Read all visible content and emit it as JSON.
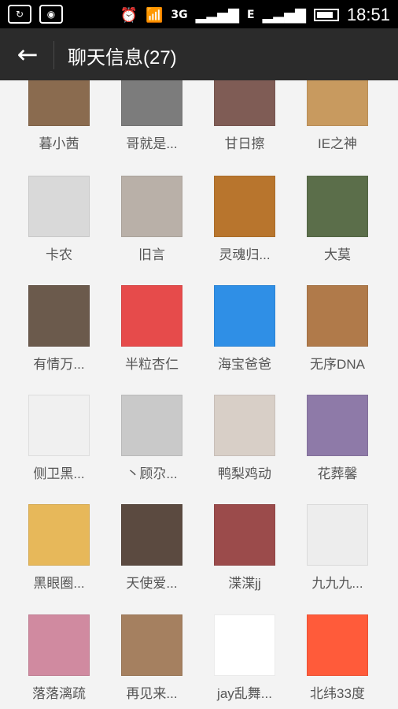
{
  "status_bar": {
    "left_icons": [
      "sync-icon",
      "shield-icon"
    ],
    "right_icons": [
      "alarm-clock-icon",
      "wifi-icon",
      "3g-icon",
      "signal-icon",
      "e-icon",
      "signal-icon",
      "battery-icon"
    ],
    "time": "18:51"
  },
  "header": {
    "back_icon": "arrow-left-icon",
    "title": "聊天信息(27)"
  },
  "members": [
    {
      "name": "暮小茜",
      "color": "#8a6b4f"
    },
    {
      "name": "哥就是...",
      "color": "#7c7c7c"
    },
    {
      "name": "甘日擦",
      "color": "#7f5c55"
    },
    {
      "name": "IE之神",
      "color": "#c89a5f"
    },
    {
      "name": "卡农",
      "color": "#d9d9d9"
    },
    {
      "name": "旧言",
      "color": "#b9b0a8"
    },
    {
      "name": "灵魂归...",
      "color": "#b8752d"
    },
    {
      "name": "大莫",
      "color": "#5b6e4a"
    },
    {
      "name": "有情万...",
      "color": "#6b5a4c"
    },
    {
      "name": "半粒杏仁",
      "color": "#e64b4b"
    },
    {
      "name": "海宝爸爸",
      "color": "#2f8fe6"
    },
    {
      "name": "无序DNA",
      "color": "#b07a4a"
    },
    {
      "name": "侧卫黑...",
      "color": "#f0f0f0"
    },
    {
      "name": "丶顾尕...",
      "color": "#c9c9c9"
    },
    {
      "name": "鸭梨鸡动",
      "color": "#d8cfc7"
    },
    {
      "name": "花葬馨",
      "color": "#8e7aa8"
    },
    {
      "name": "黑眼圈...",
      "color": "#e7b85a"
    },
    {
      "name": "天使爱...",
      "color": "#5b4a40"
    },
    {
      "name": "渫渫jj",
      "color": "#9b4b4b"
    },
    {
      "name": "九九九...",
      "color": "#ededed"
    },
    {
      "name": "落落漓疏",
      "color": "#d08aa0"
    },
    {
      "name": "再见来...",
      "color": "#a58060"
    },
    {
      "name": "jay乱舞...",
      "color": "#ffffff"
    },
    {
      "name": "北纬33度",
      "color": "#ff5b3a"
    }
  ]
}
